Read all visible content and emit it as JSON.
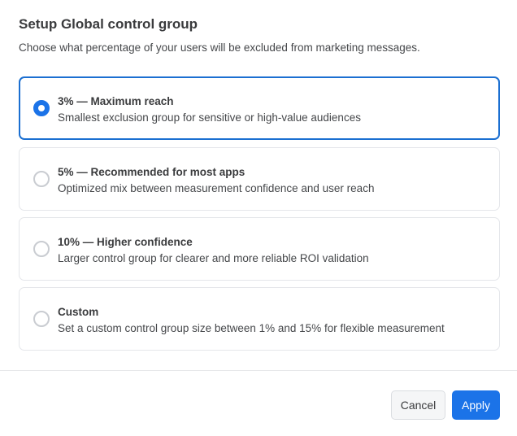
{
  "dialog": {
    "title": "Setup Global control group",
    "subtitle": "Choose what percentage of your users will be excluded from marketing messages."
  },
  "options": [
    {
      "title": "3% — Maximum reach",
      "description": "Smallest exclusion group for sensitive or high-value audiences",
      "selected": true
    },
    {
      "title": "5% — Recommended for most apps",
      "description": "Optimized mix between measurement confidence and user reach",
      "selected": false
    },
    {
      "title": "10% — Higher confidence",
      "description": "Larger control group for clearer and more reliable ROI validation",
      "selected": false
    },
    {
      "title": "Custom",
      "description": "Set a custom control group size between 1% and 15% for flexible measurement",
      "selected": false
    }
  ],
  "footer": {
    "cancel": "Cancel",
    "apply": "Apply"
  },
  "colors": {
    "accent": "#1b73e8"
  }
}
